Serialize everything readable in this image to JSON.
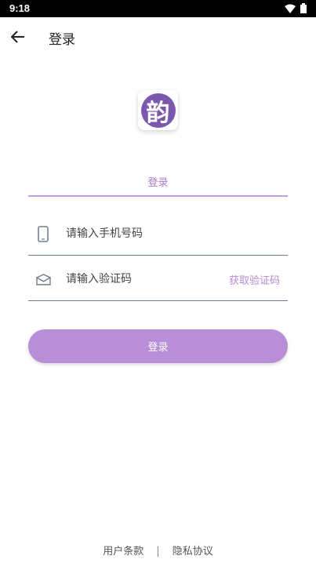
{
  "status_bar": {
    "time": "9:18"
  },
  "app_bar": {
    "title": "登录"
  },
  "logo": {
    "glyph": "韵"
  },
  "tab": {
    "label": "登录"
  },
  "phone_field": {
    "placeholder": "请输入手机号码"
  },
  "code_field": {
    "placeholder": "请输入验证码",
    "get_code_label": "获取验证码"
  },
  "login_button": {
    "label": "登录"
  },
  "footer": {
    "terms": "用户条款",
    "separator": "|",
    "privacy": "隐私协议"
  },
  "colors": {
    "accent": "#b88ed6",
    "logo_bg": "#7b57ad",
    "tab_text": "#a57ac9"
  }
}
